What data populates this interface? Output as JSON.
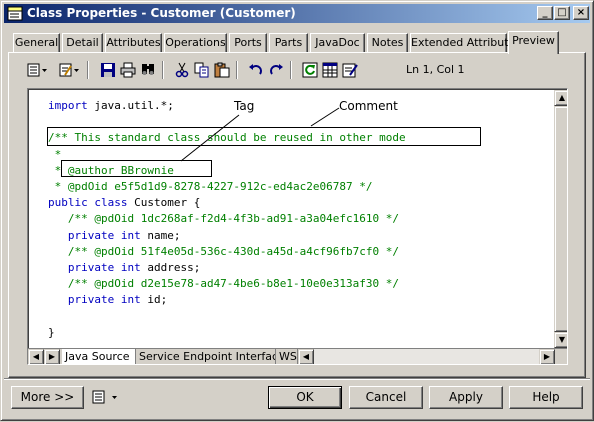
{
  "window": {
    "title": "Class Properties - Customer (Customer)",
    "controls": [
      "_",
      "□",
      "×"
    ]
  },
  "tabs": [
    "General",
    "Detail",
    "Attributes",
    "Operations",
    "Ports",
    "Parts",
    "JavaDoc",
    "Notes",
    "Extended Attributes",
    "Preview"
  ],
  "active_tab": "Preview",
  "toolbar": {
    "icons": [
      "properties-menu-icon",
      "edit-menu-icon",
      "save-icon",
      "print-icon",
      "find-icon",
      "cut-icon",
      "copy-icon",
      "paste-icon",
      "undo-icon",
      "redo-icon",
      "refresh-icon",
      "table-icon",
      "editor-icon"
    ],
    "position_label": "Ln 1, Col 1"
  },
  "code": {
    "lines": [
      [
        {
          "t": "import",
          "c": "kw"
        },
        {
          "t": " java.util.*;",
          "c": ""
        }
      ],
      [
        {
          "t": "",
          "c": ""
        }
      ],
      [
        {
          "t": "/** This standard class should be reused in other mode",
          "c": "cm"
        }
      ],
      [
        {
          "t": " *",
          "c": "cm"
        }
      ],
      [
        {
          "t": " * @author BBrownie",
          "c": "cm"
        }
      ],
      [
        {
          "t": " * @pdOid e5f5d1d9-8278-4227-912c-ed4ac2e06787 */",
          "c": "cm"
        }
      ],
      [
        {
          "t": "public class",
          "c": "kw"
        },
        {
          "t": " Customer {",
          "c": ""
        }
      ],
      [
        {
          "t": "   /** @pdOid 1dc268af-f2d4-4f3b-ad91-a3a04efc1610 */",
          "c": "cm"
        }
      ],
      [
        {
          "t": "   ",
          "c": ""
        },
        {
          "t": "private int",
          "c": "kw"
        },
        {
          "t": " name;",
          "c": ""
        }
      ],
      [
        {
          "t": "   /** @pdOid 51f4e05d-536c-430d-a45d-a4cf96fb7cf0 */",
          "c": "cm"
        }
      ],
      [
        {
          "t": "   ",
          "c": ""
        },
        {
          "t": "private int",
          "c": "kw"
        },
        {
          "t": " address;",
          "c": ""
        }
      ],
      [
        {
          "t": "   /** @pdOid d2e15e78-ad47-4be6-b8e1-10e0e313af30 */",
          "c": "cm"
        }
      ],
      [
        {
          "t": "   ",
          "c": ""
        },
        {
          "t": "private int",
          "c": "kw"
        },
        {
          "t": " id;",
          "c": ""
        }
      ],
      [
        {
          "t": "",
          "c": ""
        }
      ],
      [
        {
          "t": "}",
          "c": ""
        }
      ]
    ]
  },
  "callouts": {
    "tag_label": "Tag",
    "comment_label": "Comment"
  },
  "bottom_tabs": [
    "Java Source",
    "Service Endpoint Interface",
    "WS"
  ],
  "buttons": {
    "more": "More >>",
    "ok": "OK",
    "cancel": "Cancel",
    "apply": "Apply",
    "help": "Help"
  },
  "colors": {
    "keyword": "#0000c0",
    "comment": "#008000",
    "title_start": "#0a246a",
    "title_end": "#a6caf0"
  }
}
